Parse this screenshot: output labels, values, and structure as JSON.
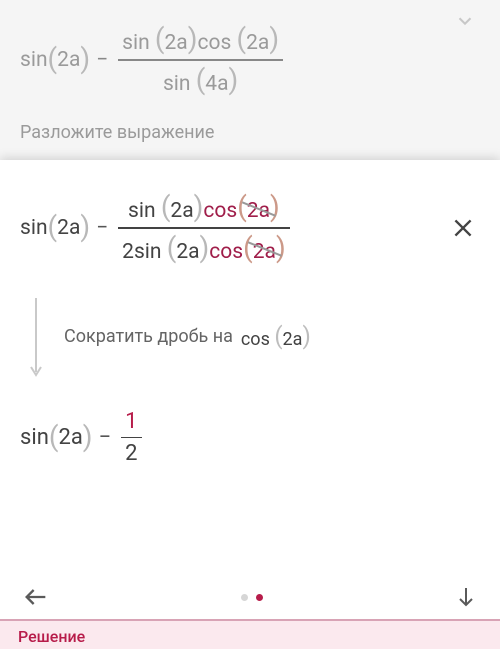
{
  "bg": {
    "sin": "sin",
    "cos": "cos",
    "arg2a": "2a",
    "arg4a": "4a",
    "subtitle": "Разложите выражение"
  },
  "panel": {
    "sin": "sin",
    "cos": "cos",
    "arg2a": "2a",
    "two": "2",
    "step_text": "Сократить дробь на",
    "step_cos": "cos",
    "step_arg": "2a",
    "result_one": "1",
    "result_two": "2"
  },
  "footer": {
    "label": "Решение"
  },
  "chart_data": {
    "type": "table",
    "title": "Algebraic simplification step",
    "original_expression": "sin(2a) - sin(2a)cos(2a)/sin(4a)",
    "expanded_expression": "sin(2a) - sin(2a)cos(2a)/(2sin(2a)cos(2a))",
    "operation": "Cancel cos(2a)",
    "result_expression": "sin(2a) - 1/2"
  }
}
